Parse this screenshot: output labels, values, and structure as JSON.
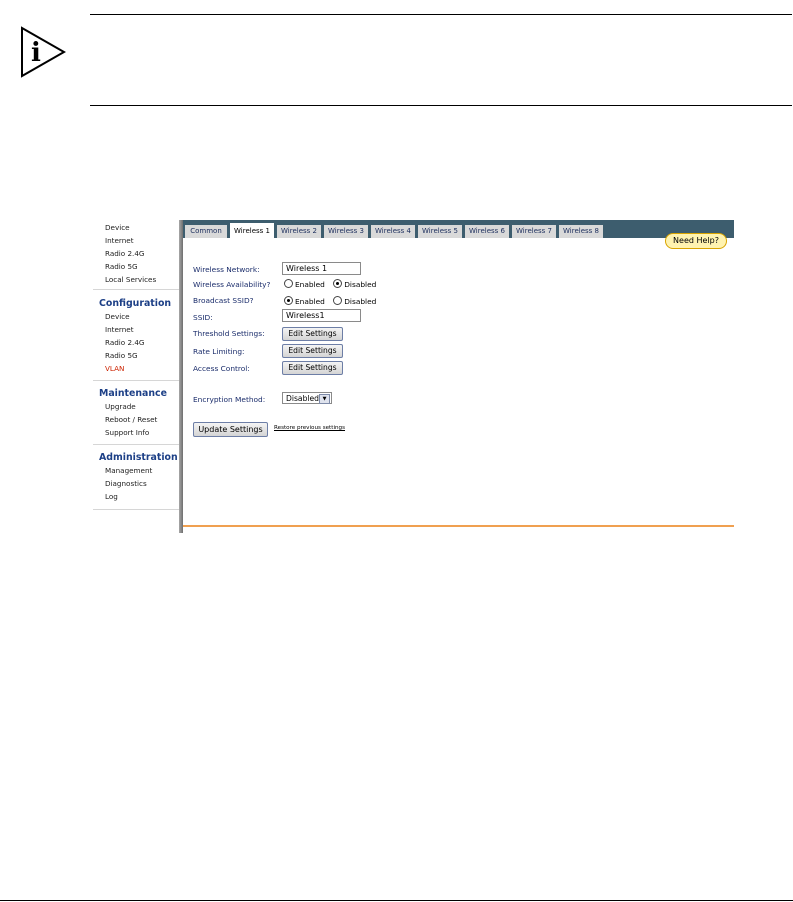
{
  "note": {
    "icon": "info-icon"
  },
  "sidebar": {
    "status_links": [
      "Device",
      "Internet",
      "Radio 2.4G",
      "Radio 5G",
      "Local Services"
    ],
    "configuration": {
      "title": "Configuration",
      "links": [
        "Device",
        "Internet",
        "Radio 2.4G",
        "Radio 5G",
        "VLAN"
      ]
    },
    "maintenance": {
      "title": "Maintenance",
      "links": [
        "Upgrade",
        "Reboot / Reset",
        "Support Info"
      ]
    },
    "administration": {
      "title": "Administration",
      "links": [
        "Management",
        "Diagnostics",
        "Log"
      ]
    }
  },
  "tabs": [
    "Common",
    "Wireless 1",
    "Wireless 2",
    "Wireless 3",
    "Wireless 4",
    "Wireless 5",
    "Wireless 6",
    "Wireless 7",
    "Wireless 8"
  ],
  "help_label": "Need Help?",
  "form": {
    "network_label": "Wireless Network:",
    "network_value": "Wireless 1",
    "availability_label": "Wireless Availability?",
    "broadcast_label": "Broadcast SSID?",
    "enabled": "Enabled",
    "disabled": "Disabled",
    "ssid_label": "SSID:",
    "ssid_value": "Wireless1",
    "threshold_label": "Threshold Settings:",
    "rate_label": "Rate Limiting:",
    "access_label": "Access Control:",
    "edit_label": "Edit Settings",
    "encryption_label": "Encryption Method:",
    "encryption_value": "Disabled",
    "update_label": "Update Settings",
    "restore_label": "Restore previous settings"
  },
  "colors": {
    "accent_orange": "#f0a050",
    "tabbar": "#3d5d6e",
    "link_active": "#cc2200"
  }
}
